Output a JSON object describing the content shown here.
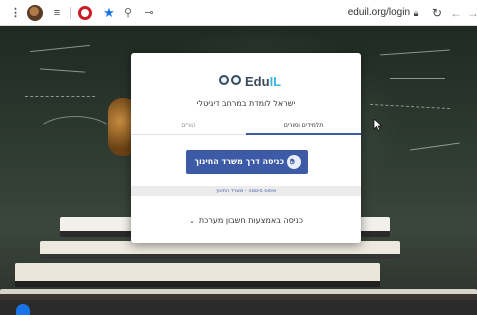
{
  "browser": {
    "url": "eduil.org/login",
    "icons": [
      "more-vert-icon",
      "profile-avatar-icon",
      "reading-list-icon",
      "opera-icon",
      "bookmark-star-icon",
      "zoom-icon",
      "key-icon",
      "lock-icon",
      "reload-icon",
      "back-icon",
      "forward-icon"
    ]
  },
  "card": {
    "logo": {
      "prefix": "Edu",
      "accent": "IL"
    },
    "subtitle": "ישראל לומדת במרחב דיגיטלי",
    "tabs": [
      {
        "label": "הורים",
        "active": false
      },
      {
        "label": "תלמידים ומורים",
        "active": true
      }
    ],
    "sso_button": "כניסה דרך משרד החינוך",
    "reset_link": "איפוס סיסמה - משרד החינוך",
    "system_login": "כניסה באמצעות חשבון מערכת"
  },
  "colors": {
    "primary": "#3c5aa6",
    "logo_accent": "#3db5e6",
    "logo_dark": "#3a4a5a"
  }
}
